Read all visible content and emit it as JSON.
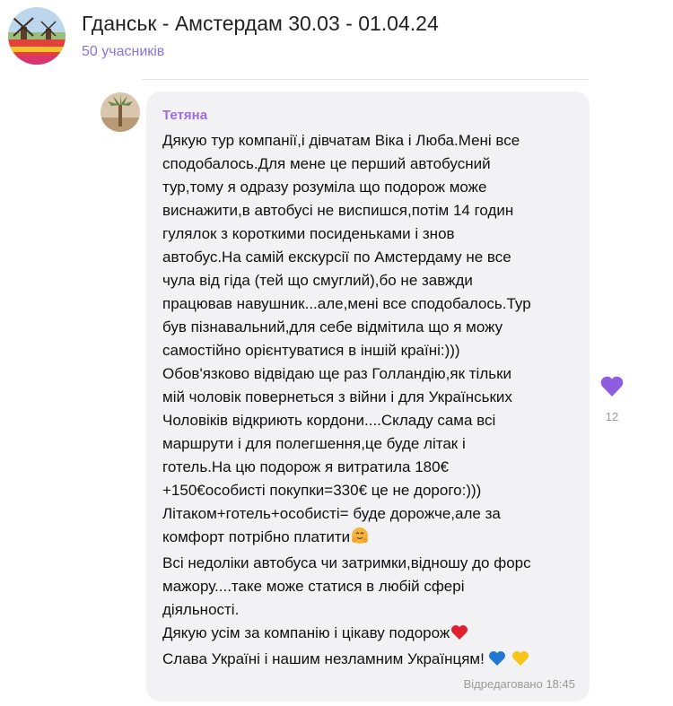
{
  "header": {
    "title": "Гданськ - Амстердам 30.03 - 01.04.24",
    "subtitle": "50 учасників",
    "avatar_icon": "tulip-field-windmill-avatar"
  },
  "message": {
    "author": "Тетяна",
    "author_color": "#9d6ee0",
    "avatar_icon": "palm-tree-avatar",
    "lines": [
      "Дякую тур компанії,і дівчатам Віка і Люба.Мені все",
      "сподобалось.Для мене це перший автобусний",
      "тур,тому я одразу розуміла що подорож може",
      "виснажити,в автобусі не виспишся,потім 14 годин",
      "гулялок з короткими посиденьками і знов",
      "автобус.На самій екскурсії по Амстердаму не все",
      "чула від гіда (тей що смуглий),бо не завжди",
      "працював навушник...але,мені все сподобалось.Тур",
      "був пізнавальний,для себе відмітила що я можу",
      "самостійно орієнтуватися в іншій країні:)))",
      "Обов'язково відвідаю ще раз Голландію,як тільки",
      "мій чоловік повернеться з війни і для Українських",
      "Чоловіків відкриють кордони....Складу сама всі",
      "маршрути і для полегшення,це буде літак і",
      "готель.На цю подорож я витратила 180€",
      "+150€особисті покупки=330€ це не дорого:)))",
      "Літаком+готель+особисті= буде дорожче,але за",
      "комфорт потрібно платити",
      "Всі недоліки автобуса чи затримки,відношу до форс",
      "мажору....таке може статися в любій сфері",
      "діяльності.",
      "Дякую усім за компанію і цікаву подорож",
      "Слава Україні і нашим незламним Українцям!"
    ],
    "emoji": {
      "hug": "hugging-face-icon",
      "heart": "red-heart-icon",
      "blue_heart": "blue-heart-icon",
      "yellow_heart": "yellow-heart-icon"
    },
    "edited_time": "Відредаговано 18:45"
  },
  "reaction": {
    "icon": "purple-heart-icon",
    "color": "#8e5de0",
    "count": "12"
  }
}
